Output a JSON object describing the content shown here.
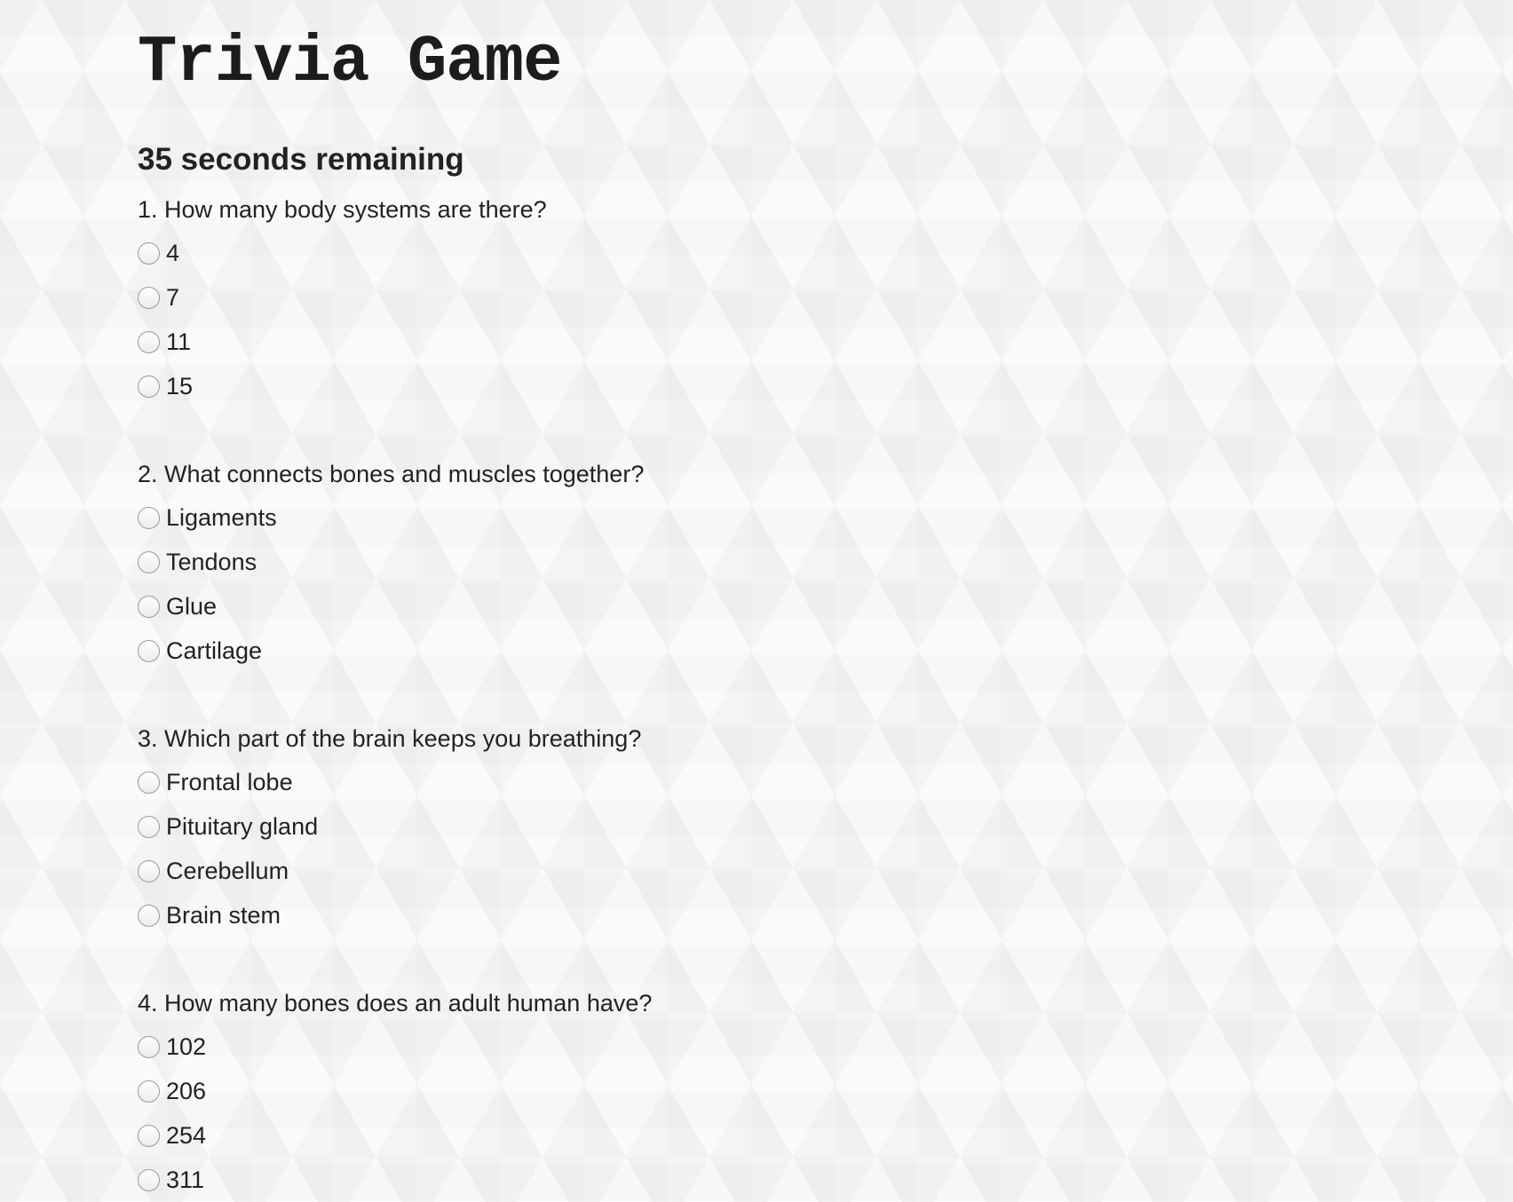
{
  "title": "Trivia Game",
  "timer": "35 seconds remaining",
  "questions": [
    {
      "text": "1. How many body systems are there?",
      "options": [
        "4",
        "7",
        "11",
        "15"
      ]
    },
    {
      "text": "2. What connects bones and muscles together?",
      "options": [
        "Ligaments",
        "Tendons",
        "Glue",
        "Cartilage"
      ]
    },
    {
      "text": "3. Which part of the brain keeps you breathing?",
      "options": [
        "Frontal lobe",
        "Pituitary gland",
        "Cerebellum",
        "Brain stem"
      ]
    },
    {
      "text": "4. How many bones does an adult human have?",
      "options": [
        "102",
        "206",
        "254",
        "311"
      ]
    }
  ]
}
